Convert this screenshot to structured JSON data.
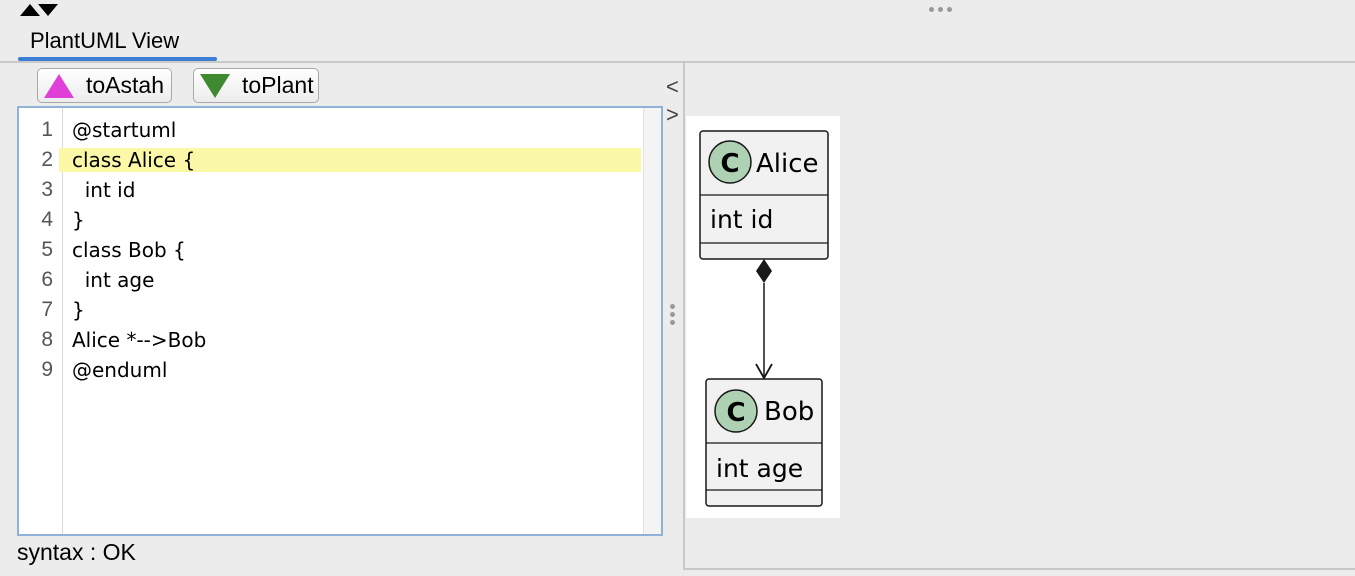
{
  "tab": {
    "label": "PlantUML View"
  },
  "toolbar": {
    "to_astah_label": "toAstah",
    "to_astah_icon": "magenta-up-triangle-icon",
    "to_plant_label": "toPlant",
    "to_plant_icon": "green-down-triangle-icon"
  },
  "editor": {
    "highlighted_line": 2,
    "lines": [
      {
        "num": "1",
        "code": "@startuml"
      },
      {
        "num": "2",
        "code": "class Alice {"
      },
      {
        "num": "3",
        "code": "  int id"
      },
      {
        "num": "4",
        "code": "}"
      },
      {
        "num": "5",
        "code": "class Bob {"
      },
      {
        "num": "6",
        "code": "  int age"
      },
      {
        "num": "7",
        "code": "}"
      },
      {
        "num": "8",
        "code": "Alice *-->Bob"
      },
      {
        "num": "9",
        "code": "@enduml"
      }
    ]
  },
  "status": {
    "text": "syntax : OK"
  },
  "splitter": {
    "left_arrow": "<",
    "right_arrow": ">"
  },
  "diagram": {
    "classes": [
      {
        "name": "Alice",
        "stereotype_letter": "C",
        "attribute": "int id"
      },
      {
        "name": "Bob",
        "stereotype_letter": "C",
        "attribute": "int age"
      }
    ],
    "relation": "composition"
  },
  "colors": {
    "accent": "#3c7fd2",
    "highlight": "#fbf8a8",
    "class_circle": "#add1b2",
    "astah_icon": "#e040d8",
    "plant_icon": "#3f8a31"
  }
}
